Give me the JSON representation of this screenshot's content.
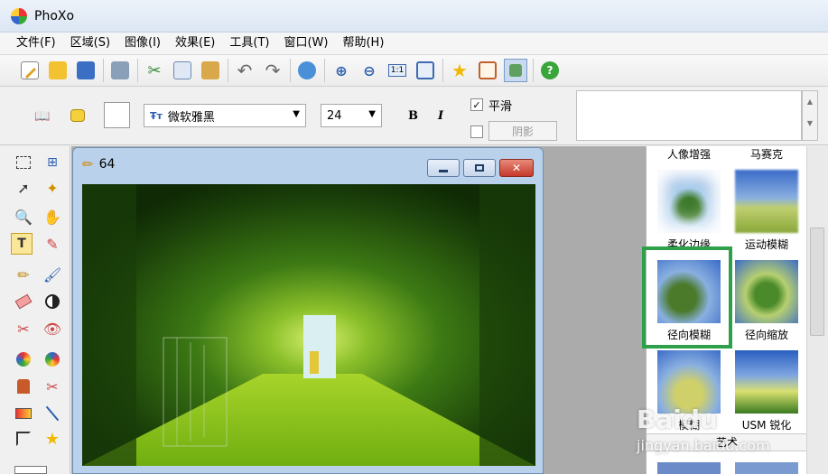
{
  "app": {
    "title": "PhoXo"
  },
  "menu": [
    "文件(F)",
    "区域(S)",
    "图像(I)",
    "效果(E)",
    "工具(T)",
    "窗口(W)",
    "帮助(H)"
  ],
  "toolbar": {
    "buttons": [
      "new-icon",
      "open-icon",
      "save-icon",
      "print-icon",
      "cut-icon",
      "copy-icon",
      "paste-icon",
      "undo-icon",
      "redo-icon",
      "refresh-icon",
      "zoom-in-icon",
      "zoom-out-icon",
      "actual-size-icon",
      "fit-window-icon",
      "favorite-icon",
      "frame-icon",
      "layers-icon",
      "help-icon"
    ]
  },
  "textbar": {
    "font_name": "微软雅黑",
    "font_size": "24",
    "bold_label": "B",
    "italic_label": "I",
    "smooth_label": "平滑",
    "shadow_label": "阴影",
    "smooth_checked": true,
    "shadow_checked": false
  },
  "document": {
    "title": "64"
  },
  "effects": {
    "top_labels": [
      "人像增强",
      "马赛克"
    ],
    "items": [
      {
        "label": "柔化边缘"
      },
      {
        "label": "运动模糊"
      },
      {
        "label": "径向模糊",
        "selected": true
      },
      {
        "label": "径向缩放"
      },
      {
        "label": "模糊"
      },
      {
        "label": "USM 锐化"
      }
    ],
    "section_label": "艺术"
  },
  "watermark": {
    "brand": "Baidu",
    "site": "jingyan.baidu.com"
  },
  "colors": {
    "selection": "#2ea04a",
    "workspace": "#ababab",
    "window_frame": "#b9d1ea"
  }
}
